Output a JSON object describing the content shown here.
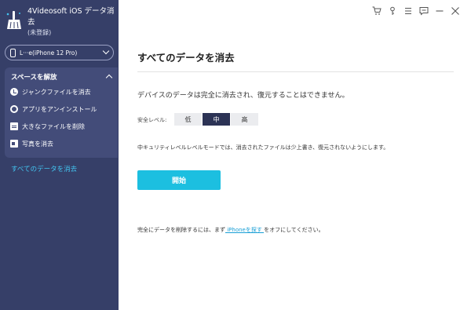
{
  "app": {
    "title": "4Videosoft iOS データ消去",
    "subtitle": "(未登録)"
  },
  "device": {
    "label": "L···e(iPhone 12 Pro)"
  },
  "sidebar": {
    "section_title": "スペースを解放",
    "items": [
      {
        "label": "ジャンクファイルを消去",
        "icon": "clean-icon"
      },
      {
        "label": "アプリをアンインストール",
        "icon": "app-gear-icon"
      },
      {
        "label": "大きなファイルを削除",
        "icon": "large-file-icon"
      },
      {
        "label": "写真を消去",
        "icon": "photo-icon"
      }
    ],
    "active_item": "すべてのデータを消去"
  },
  "toolbar": {
    "icons": [
      "cart-icon",
      "key-icon",
      "menu-icon",
      "feedback-icon",
      "minimize-icon",
      "close-icon"
    ]
  },
  "main": {
    "title": "すべてのデータを消去",
    "description": "デバイスのデータは完全に消去され、復元することはできません。",
    "level_label": "安全レベル:",
    "levels": [
      "低",
      "中",
      "高"
    ],
    "selected_level": "中",
    "level_description": "中キュリティレベルレベルモードでは、消去されたファイルは少上書き、復元されないようにします。",
    "start_label": "開始",
    "note_prefix": "完全にデータを削除するには、まず",
    "note_link": " iPhoneを探す ",
    "note_suffix": "をオフにしてください。"
  },
  "colors": {
    "sidebar_bg": "#363f68",
    "section_bg": "#434c79",
    "accent": "#1cbfe0",
    "active_text": "#42c4f0",
    "selected_level_bg": "#2c3355"
  }
}
